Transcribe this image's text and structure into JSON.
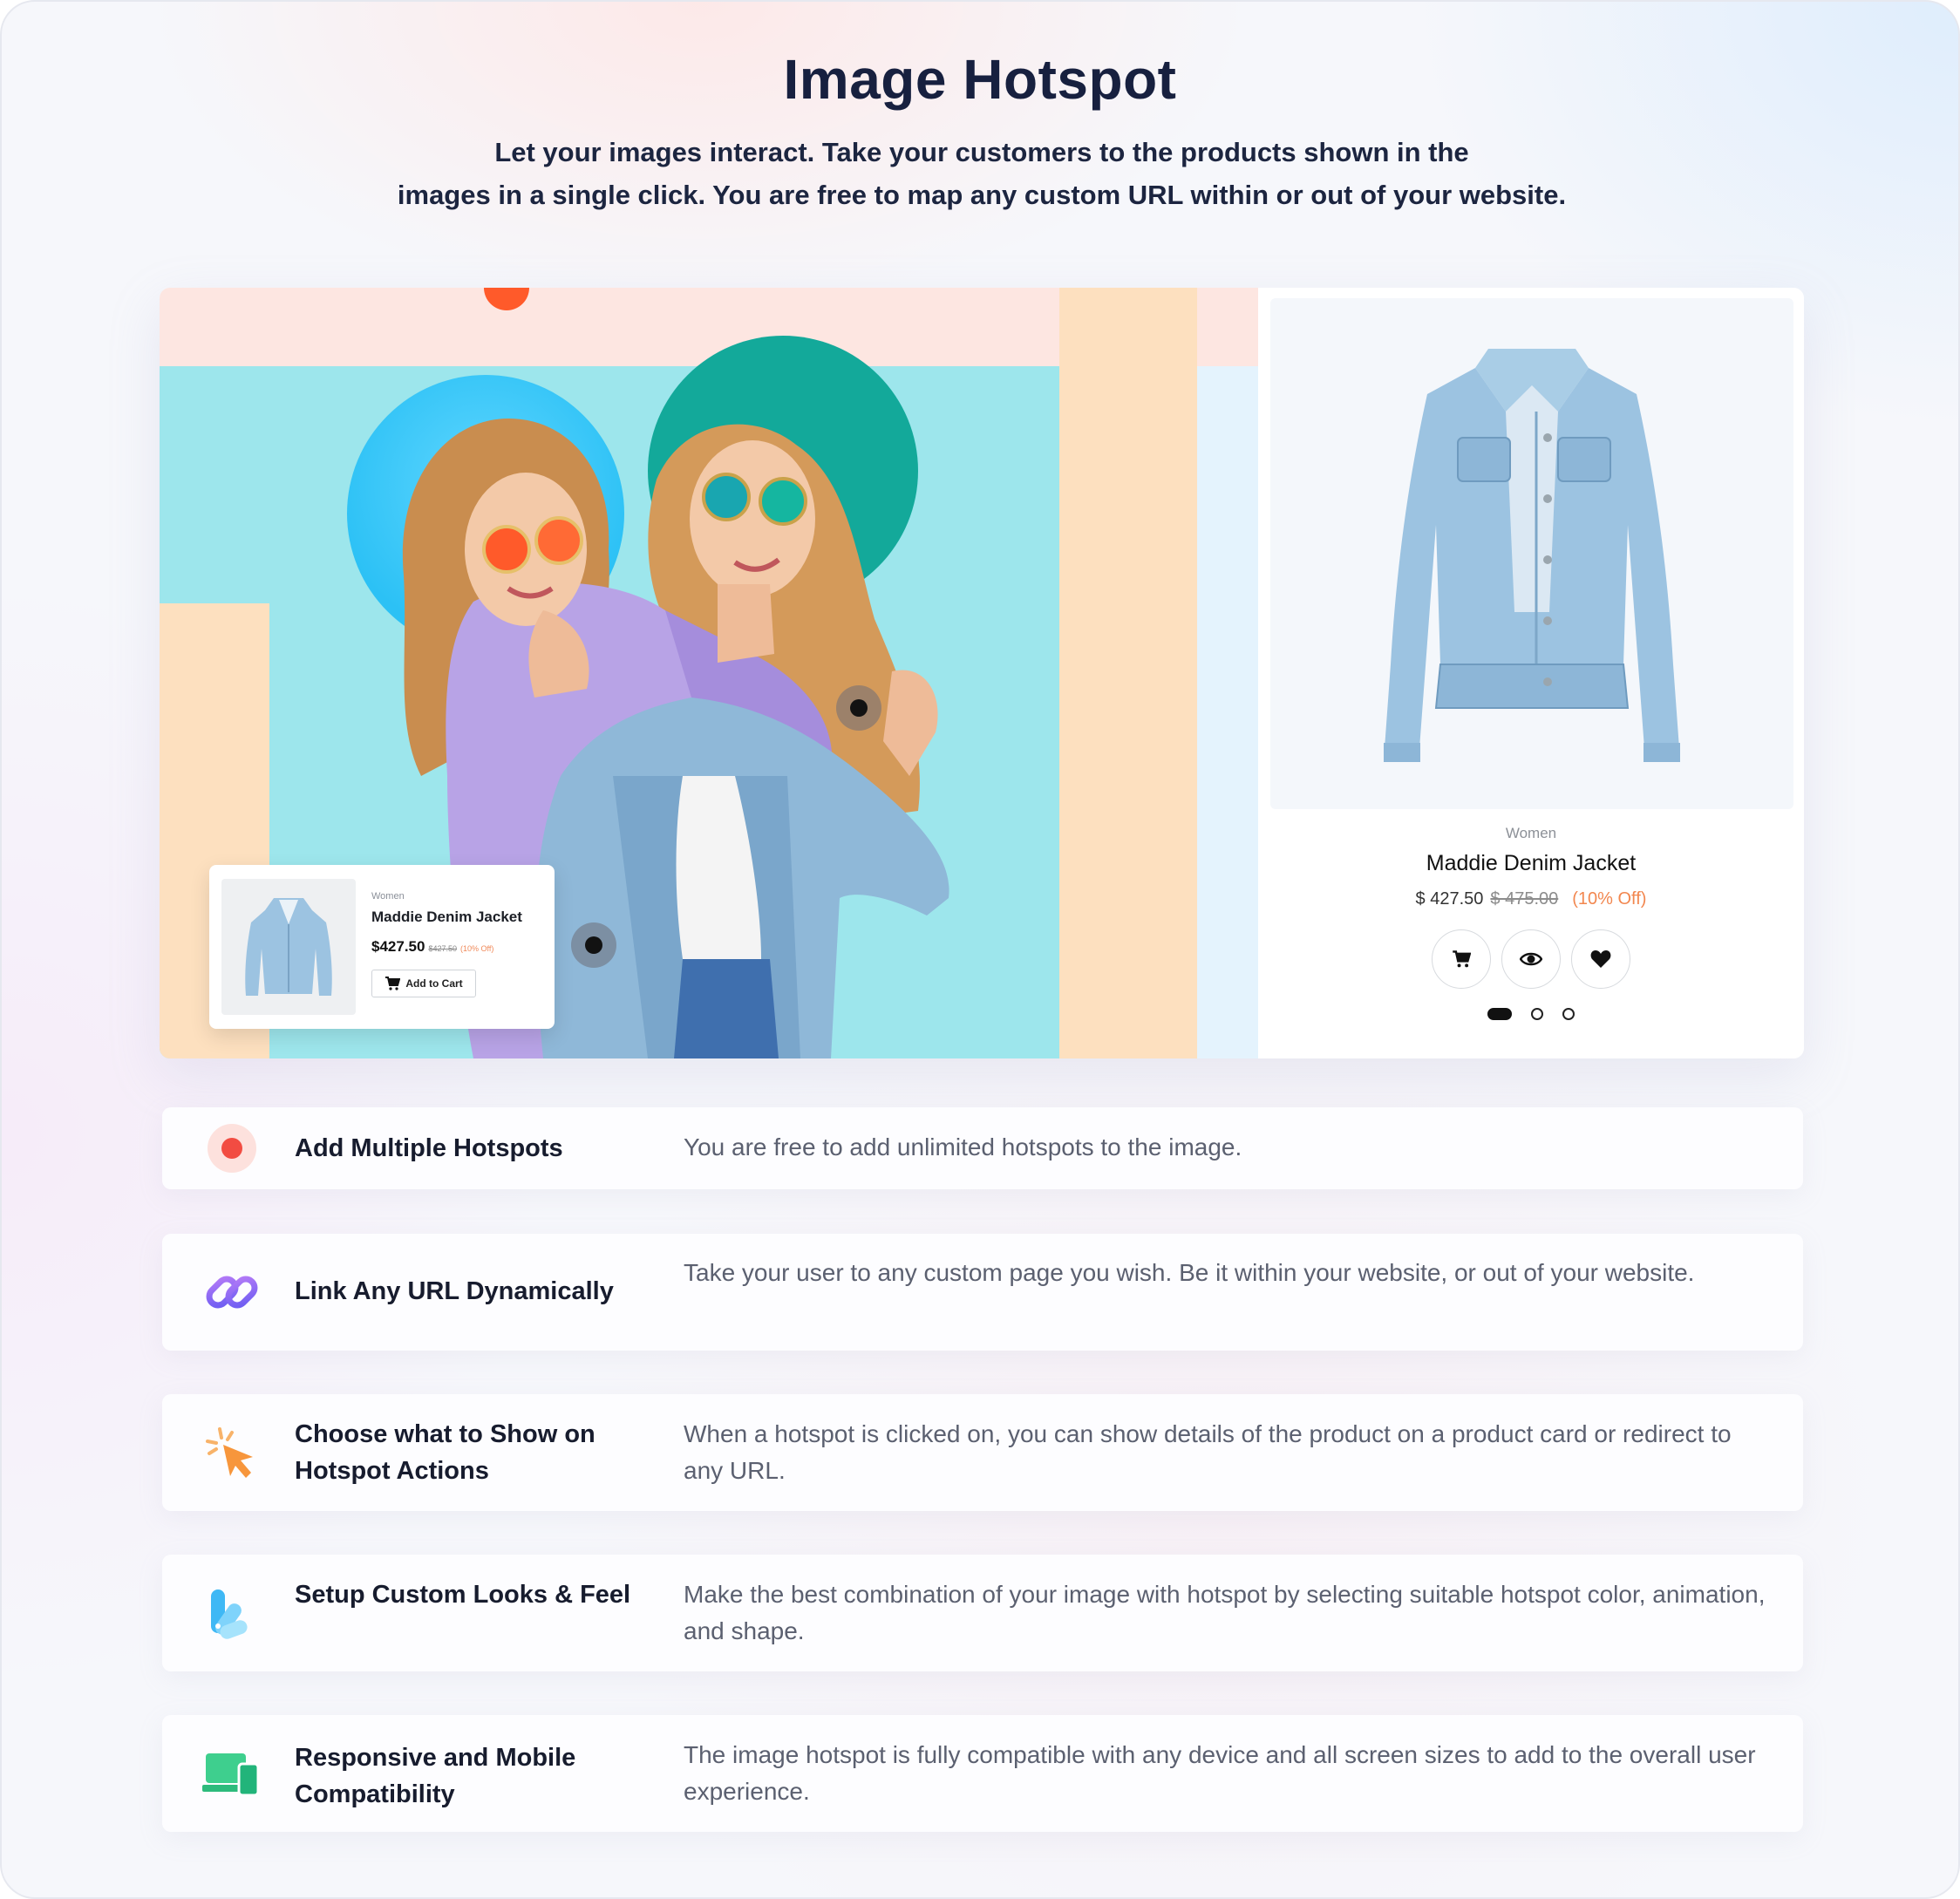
{
  "header": {
    "title": "Image Hotspot",
    "subtitle_line1": "Let your images interact. Take your customers to the products shown in the",
    "subtitle_line2": "images in a single click. You are free to map any custom URL within or out of your website."
  },
  "hotspot_popup": {
    "category": "Women",
    "name": "Maddie Denim Jacket",
    "price": "$427.50",
    "old_price": "$427.50",
    "discount": "(10% Off)",
    "button_label": "Add to Cart"
  },
  "product_card": {
    "category": "Women",
    "name": "Maddie Denim Jacket",
    "price": "$ 427.50",
    "old_price": "$ 475.00",
    "discount": "(10% Off)",
    "actions": [
      "cart-icon",
      "eye-icon",
      "heart-icon"
    ],
    "carousel_pages": 3,
    "carousel_active": 1
  },
  "features": [
    {
      "title": "Add Multiple Hotspots",
      "desc": "You are free to add unlimited hotspots to the image.",
      "icon": "hotspot-dot-icon"
    },
    {
      "title": "Link Any URL Dynamically",
      "desc": "Take your user to any custom page you wish. Be it within your website, or out of your website.",
      "icon": "link-icon"
    },
    {
      "title": "Choose what to Show on Hotspot Actions",
      "desc": "When a hotspot is clicked on, you can show details of the product on a product card or redirect to any URL.",
      "icon": "cursor-click-icon"
    },
    {
      "title": "Setup Custom Looks & Feel",
      "desc": "Make the best combination of your image with hotspot by selecting suitable hotspot color, animation, and shape.",
      "icon": "palette-icon"
    },
    {
      "title": "Responsive and Mobile Compatibility",
      "desc": "The image hotspot is fully compatible with any device and all screen sizes to add to the overall user experience.",
      "icon": "devices-icon"
    }
  ],
  "colors": {
    "title": "#17203f",
    "accent_orange": "#f2874f",
    "hero_blue": "#9de6ec",
    "hero_peach": "#fde0bf",
    "hero_pink": "#fde6e1",
    "teal": "#13a99a"
  }
}
